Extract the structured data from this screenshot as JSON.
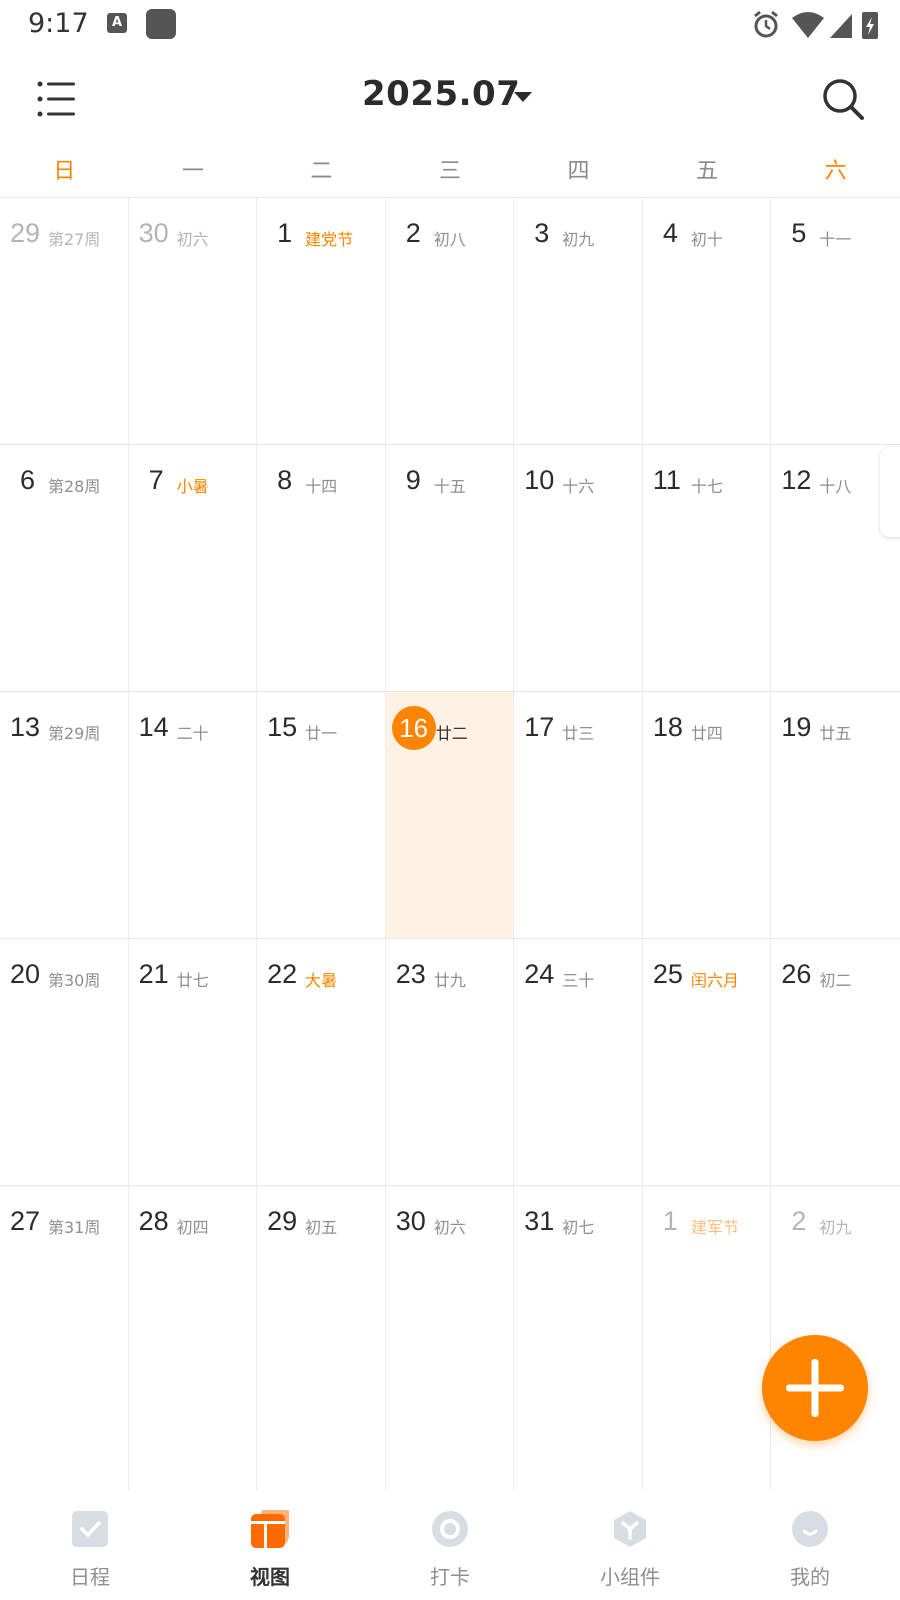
{
  "status_bar": {
    "time": "9:17",
    "input_badge": "A"
  },
  "header": {
    "month": "2025.07"
  },
  "weekdays": [
    "日",
    "一",
    "二",
    "三",
    "四",
    "五",
    "六"
  ],
  "weeks": [
    [
      {
        "day": "29",
        "lunar": "第27周",
        "other": true
      },
      {
        "day": "30",
        "lunar": "初六",
        "other": true
      },
      {
        "day": "1",
        "lunar": "建党节",
        "holiday": true
      },
      {
        "day": "2",
        "lunar": "初八"
      },
      {
        "day": "3",
        "lunar": "初九"
      },
      {
        "day": "4",
        "lunar": "初十"
      },
      {
        "day": "5",
        "lunar": "十一"
      }
    ],
    [
      {
        "day": "6",
        "lunar": "第28周"
      },
      {
        "day": "7",
        "lunar": "小暑",
        "holiday": true
      },
      {
        "day": "8",
        "lunar": "十四"
      },
      {
        "day": "9",
        "lunar": "十五"
      },
      {
        "day": "10",
        "lunar": "十六"
      },
      {
        "day": "11",
        "lunar": "十七"
      },
      {
        "day": "12",
        "lunar": "十八"
      }
    ],
    [
      {
        "day": "13",
        "lunar": "第29周"
      },
      {
        "day": "14",
        "lunar": "二十"
      },
      {
        "day": "15",
        "lunar": "廿一"
      },
      {
        "day": "16",
        "lunar": "廿二",
        "today": true
      },
      {
        "day": "17",
        "lunar": "廿三"
      },
      {
        "day": "18",
        "lunar": "廿四"
      },
      {
        "day": "19",
        "lunar": "廿五"
      }
    ],
    [
      {
        "day": "20",
        "lunar": "第30周"
      },
      {
        "day": "21",
        "lunar": "廿七"
      },
      {
        "day": "22",
        "lunar": "大暑",
        "holiday": true
      },
      {
        "day": "23",
        "lunar": "廿九"
      },
      {
        "day": "24",
        "lunar": "三十"
      },
      {
        "day": "25",
        "lunar": "闰六月",
        "holiday": true
      },
      {
        "day": "26",
        "lunar": "初二"
      }
    ],
    [
      {
        "day": "27",
        "lunar": "第31周"
      },
      {
        "day": "28",
        "lunar": "初四"
      },
      {
        "day": "29",
        "lunar": "初五"
      },
      {
        "day": "30",
        "lunar": "初六"
      },
      {
        "day": "31",
        "lunar": "初七"
      },
      {
        "day": "1",
        "lunar": "建军节",
        "holiday": true,
        "other": true
      },
      {
        "day": "2",
        "lunar": "初九",
        "other": true
      }
    ]
  ],
  "bottom_nav": [
    {
      "label": "日程",
      "icon": "checkbox-icon",
      "active": false
    },
    {
      "label": "视图",
      "icon": "calendar-view-icon",
      "active": true
    },
    {
      "label": "打卡",
      "icon": "checkin-circle-icon",
      "active": false
    },
    {
      "label": "小组件",
      "icon": "widget-cube-icon",
      "active": false
    },
    {
      "label": "我的",
      "icon": "smile-profile-icon",
      "active": false
    }
  ],
  "colors": {
    "accent": "#ff8400",
    "today_bg": "#fff1e4",
    "muted": "#8f8f8f"
  }
}
